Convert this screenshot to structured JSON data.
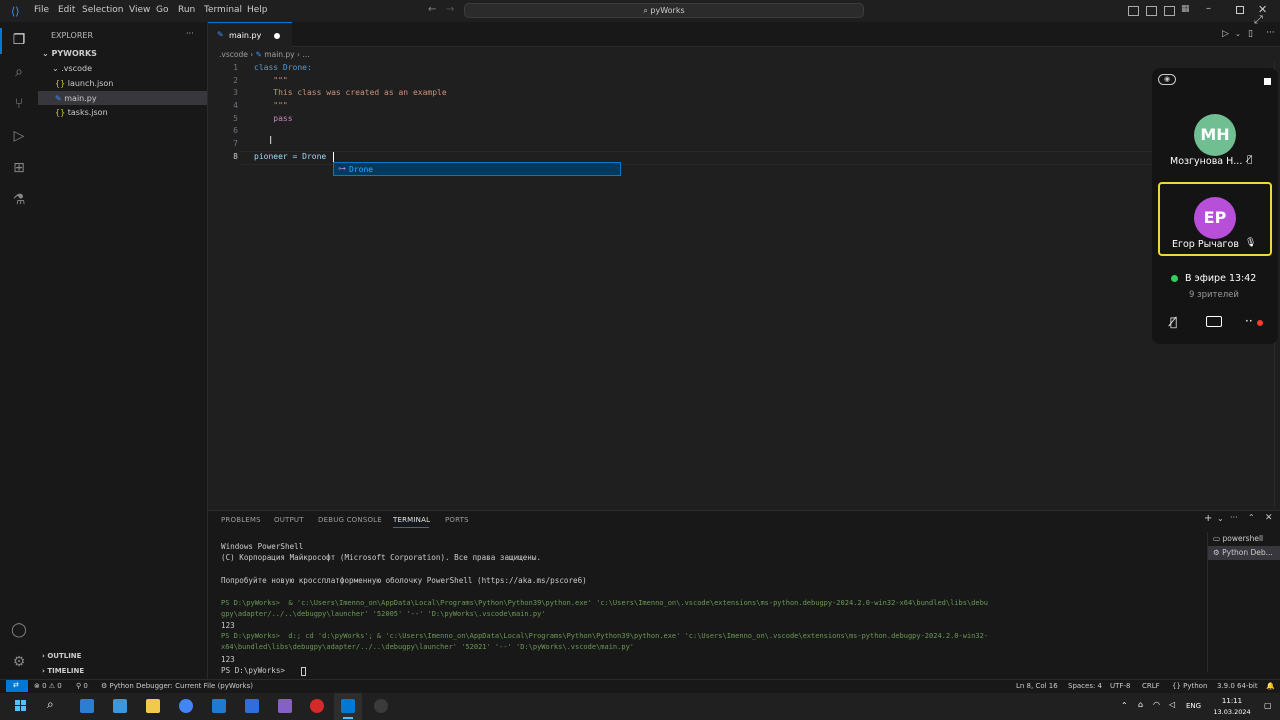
{
  "titlebar": {
    "menu": [
      "File",
      "Edit",
      "Selection",
      "View",
      "Go",
      "Run",
      "Terminal",
      "Help"
    ],
    "search": "pyWorks"
  },
  "sidebar": {
    "title": "EXPLORER",
    "root": "PYWORKS",
    "folder": ".vscode",
    "files": [
      "launch.json",
      "main.py",
      "tasks.json"
    ],
    "outline": "OUTLINE",
    "timeline": "TIMELINE"
  },
  "editor": {
    "tab": "main.py",
    "breadcrumb": [
      ".vscode",
      "main.py",
      "..."
    ],
    "lines": [
      {
        "n": "1",
        "text": "class Drone:"
      },
      {
        "n": "2",
        "text": "    \"\"\""
      },
      {
        "n": "3",
        "text": "    This class was created as an example"
      },
      {
        "n": "4",
        "text": "    \"\"\""
      },
      {
        "n": "5",
        "text": "    pass"
      },
      {
        "n": "6",
        "text": ""
      },
      {
        "n": "7",
        "text": ""
      },
      {
        "n": "8",
        "text": "pioneer = Drone"
      }
    ],
    "suggestion": "Drone"
  },
  "panel": {
    "tabs": [
      "PROBLEMS",
      "OUTPUT",
      "DEBUG CONSOLE",
      "TERMINAL",
      "PORTS"
    ],
    "terminals": [
      "powershell",
      "Python Deb..."
    ],
    "output": [
      "Windows PowerShell",
      "(C) Корпорация Майкрософт (Microsoft Corporation). Все права защищены.",
      "",
      "Попробуйте новую кроссплатформенную оболочку PowerShell (https://aka.ms/pscore6)",
      "",
      "PS D:\\pyWorks>  & 'c:\\Users\\Imenno_on\\AppData\\Local\\Programs\\Python\\Python39\\python.exe' 'c:\\Users\\Imenno_on\\.vscode\\extensions\\ms-python.debugpy-2024.2.0-win32-x64\\bundled\\libs\\debu",
      "gpy\\adapter/../..\\debugpy\\launcher' '52005' '--' 'D:\\pyWorks\\.vscode\\main.py'",
      "123",
      "PS D:\\pyWorks>  d:; cd 'd:\\pyWorks'; & 'c:\\Users\\Imenno_on\\AppData\\Local\\Programs\\Python\\Python39\\python.exe' 'c:\\Users\\Imenno_on\\.vscode\\extensions\\ms-python.debugpy-2024.2.0-win32-",
      "x64\\bundled\\libs\\debugpy\\adapter/../..\\debugpy\\launcher' '52021' '--' 'D:\\pyWorks\\.vscode\\main.py'",
      "123",
      "PS D:\\pyWorks> "
    ]
  },
  "statusbar": {
    "errors": "0",
    "warnings": "0",
    "ports": "0",
    "debug": "Python Debugger: Current File (pyWorks)",
    "position": "Ln 8, Col 16",
    "spaces": "Spaces: 4",
    "encoding": "UTF-8",
    "eol": "CRLF",
    "language": "Python",
    "interpreter": "3.9.0 64-bit"
  },
  "taskbar": {
    "lang": "ENG",
    "time": "11:11",
    "date": "13.03.2024"
  },
  "call": {
    "participants": [
      {
        "initials": "МН",
        "name": "Мозгунова Н...",
        "color": "#6fbf92"
      },
      {
        "initials": "ЕР",
        "name": "Егор Рычагов",
        "color": "#b84fd9"
      }
    ],
    "live": "В эфире 13:42",
    "viewers": "9 зрителей"
  }
}
